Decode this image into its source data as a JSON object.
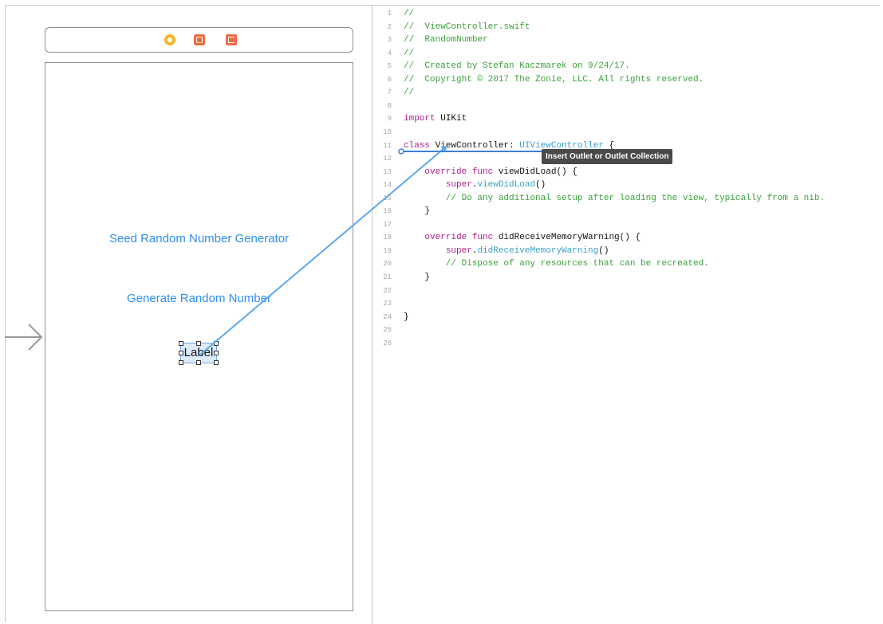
{
  "storyboard": {
    "buttons": {
      "seed": "Seed Random Number Generator",
      "generate": "Generate Random Number"
    },
    "label_text": "Label",
    "dock_icons": [
      "view-controller-icon",
      "first-responder-icon",
      "exit-icon"
    ]
  },
  "editor": {
    "lines": [
      {
        "n": "1",
        "code": "//"
      },
      {
        "n": "2",
        "code": "//  ViewController.swift"
      },
      {
        "n": "3",
        "code": "//  RandomNumber"
      },
      {
        "n": "4",
        "code": "//"
      },
      {
        "n": "5",
        "code": "//  Created by Stefan Kaczmarek on 9/24/17."
      },
      {
        "n": "6",
        "code": "//  Copyright © 2017 The Zonie, LLC. All rights reserved."
      },
      {
        "n": "7",
        "code": "//"
      },
      {
        "n": "8",
        "code": ""
      },
      {
        "n": "9",
        "code": "import UIKit"
      },
      {
        "n": "10",
        "code": ""
      },
      {
        "n": "11",
        "code": "class ViewController: UIViewController {"
      },
      {
        "n": "12",
        "code": ""
      },
      {
        "n": "13",
        "code": "    override func viewDidLoad() {"
      },
      {
        "n": "14",
        "code": "        super.viewDidLoad()"
      },
      {
        "n": "15",
        "code": "        // Do any additional setup after loading the view, typically from a nib."
      },
      {
        "n": "16",
        "code": "    }"
      },
      {
        "n": "17",
        "code": ""
      },
      {
        "n": "18",
        "code": "    override func didReceiveMemoryWarning() {"
      },
      {
        "n": "19",
        "code": "        super.didReceiveMemoryWarning()"
      },
      {
        "n": "20",
        "code": "        // Dispose of any resources that can be recreated."
      },
      {
        "n": "21",
        "code": "    }"
      },
      {
        "n": "22",
        "code": ""
      },
      {
        "n": "23",
        "code": ""
      },
      {
        "n": "24",
        "code": "}"
      },
      {
        "n": "25",
        "code": ""
      },
      {
        "n": "26",
        "code": ""
      }
    ],
    "tooltip": "Insert Outlet or Outlet Collection"
  },
  "colors": {
    "accent": "#2f8ef0",
    "connection": "#5aa9f0",
    "comment": "#3aa23a",
    "keyword": "#b5208f",
    "type": "#3aa0c8"
  }
}
